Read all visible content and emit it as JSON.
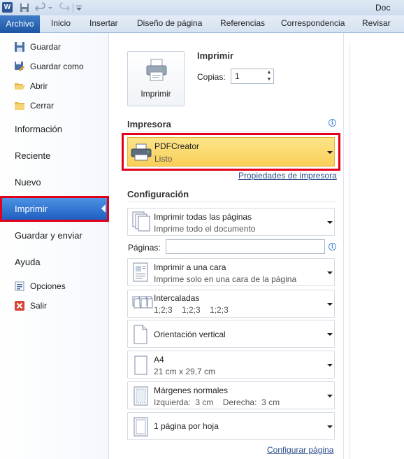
{
  "titlebar": {
    "logo": "W",
    "doc_title": "Doc"
  },
  "ribbon": {
    "file_tab": "Archivo",
    "tabs": [
      "Inicio",
      "Insertar",
      "Diseño de página",
      "Referencias",
      "Correspondencia",
      "Revisar"
    ]
  },
  "nav": {
    "commands_top": [
      {
        "label": "Guardar",
        "icon": "save-icon"
      },
      {
        "label": "Guardar como",
        "icon": "save-as-icon"
      },
      {
        "label": "Abrir",
        "icon": "open-folder-icon"
      },
      {
        "label": "Cerrar",
        "icon": "close-folder-icon"
      }
    ],
    "tabs": [
      "Información",
      "Reciente",
      "Nuevo",
      "Imprimir",
      "Guardar y enviar",
      "Ayuda"
    ],
    "active_tab": "Imprimir",
    "commands_bottom": [
      {
        "label": "Opciones",
        "icon": "options-icon"
      },
      {
        "label": "Salir",
        "icon": "exit-icon"
      }
    ]
  },
  "print": {
    "button_label": "Imprimir",
    "section_title": "Imprimir",
    "copies_label": "Copias:",
    "copies_value": "1"
  },
  "printer": {
    "section_title": "Impresora",
    "name": "PDFCreator",
    "status": "Listo",
    "properties_link": "Propiedades de impresora",
    "highlight_color": "#e0001a"
  },
  "config": {
    "section_title": "Configuración",
    "pages_label": "Páginas:",
    "pages_value": "",
    "options": [
      {
        "title": "Imprimir todas las páginas",
        "subtitle": "Imprime todo el documento",
        "icon": "all-pages-icon"
      },
      {
        "title": "Imprimir a una cara",
        "subtitle": "Imprime solo en una cara de la página",
        "icon": "one-sided-icon"
      },
      {
        "title": "Intercaladas",
        "subtitle": "1;2;3    1;2;3    1;2;3",
        "icon": "collated-icon"
      },
      {
        "title": "Orientación vertical",
        "subtitle": "",
        "icon": "portrait-icon"
      },
      {
        "title": "A4",
        "subtitle": "21 cm x 29,7 cm",
        "icon": "paper-size-icon"
      },
      {
        "title": "Márgenes normales",
        "subtitle": "Izquierda:  3 cm    Derecha:  3 cm",
        "icon": "margins-icon"
      },
      {
        "title": "1 página por hoja",
        "subtitle": "",
        "icon": "pages-per-sheet-icon"
      }
    ],
    "page_setup_link": "Configurar página"
  }
}
